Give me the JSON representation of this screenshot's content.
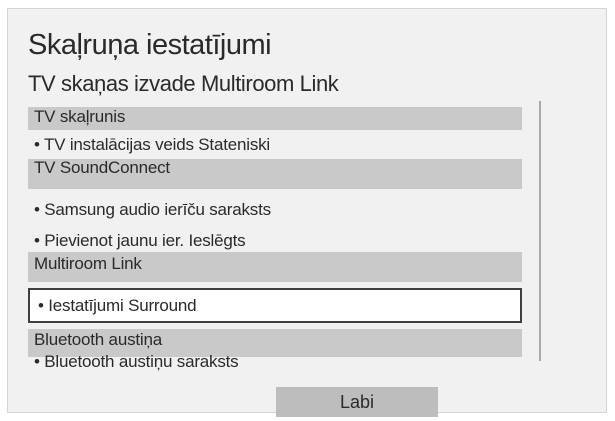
{
  "dialog": {
    "title": "Skaļruņa iestatījumi",
    "subtitle": "TV skaņas izvade Multiroom Link"
  },
  "list": {
    "tv_speaker_header": "TV skaļrunis",
    "tv_install_type": "• TV instalācijas veids Stateniski",
    "soundconnect_header": "TV SoundConnect",
    "samsung_audio_list": "• Samsung audio ierīču saraksts",
    "add_new_device": "• Pievienot jaunu ier. Ieslēgts",
    "multiroom_header": "Multiroom Link",
    "settings_surround": "• Iestatījumi Surround",
    "bluetooth_header": "Bluetooth austiņa",
    "bluetooth_list": "• Bluetooth austiņu saraksts"
  },
  "buttons": {
    "ok_label": "Labi"
  },
  "colors": {
    "header_background": "#c9c9c9",
    "panel_background": "#f1f1f1",
    "selection_border": "#3f3f3f",
    "button_background": "#bdbdbd"
  }
}
